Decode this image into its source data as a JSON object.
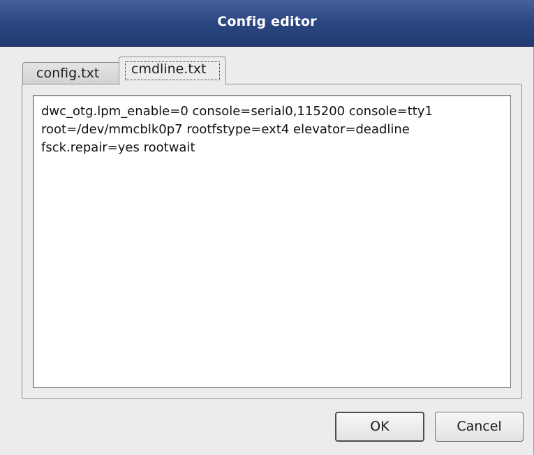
{
  "window": {
    "title": "Config editor"
  },
  "tabs": [
    {
      "label": "config.txt",
      "active": false
    },
    {
      "label": "cmdline.txt",
      "active": true
    }
  ],
  "editor": {
    "lines": [
      "dwc_otg.lpm_enable=0 console=serial0,115200 console=tty1",
      "root=/dev/mmcblk0p7 rootfstype=ext4 elevator=deadline",
      "fsck.repair=yes rootwait"
    ]
  },
  "buttons": {
    "ok_label": "OK",
    "cancel_label": "Cancel"
  },
  "colors": {
    "titlebar": "#2b4680",
    "dialog_background": "#ececec",
    "editor_background": "#ffffff"
  }
}
